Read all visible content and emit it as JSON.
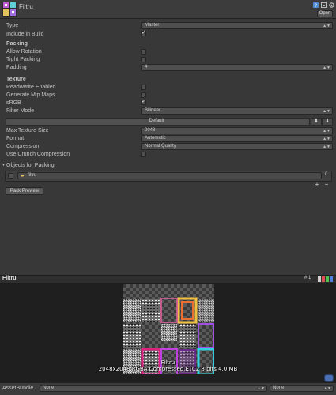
{
  "header": {
    "title": "Filtru",
    "open_label": "Open"
  },
  "settings": {
    "type_label": "Type",
    "type_value": "Master",
    "include_in_build_label": "Include in Build",
    "include_in_build": true,
    "packing_title": "Packing",
    "allow_rotation_label": "Allow Rotation",
    "allow_rotation": false,
    "tight_packing_label": "Tight Packing",
    "tight_packing": false,
    "padding_label": "Padding",
    "padding_value": "4",
    "texture_title": "Texture",
    "read_write_label": "Read/Write Enabled",
    "read_write": false,
    "mip_maps_label": "Generate Mip Maps",
    "mip_maps": false,
    "srgb_label": "sRGB",
    "srgb": true,
    "filter_mode_label": "Filter Mode",
    "filter_mode_value": "Bilinear"
  },
  "platform": {
    "tab_label": "Default",
    "max_texture_size_label": "Max Texture Size",
    "max_texture_size_value": "2048",
    "format_label": "Format",
    "format_value": "Automatic",
    "compression_label": "Compression",
    "compression_value": "Normal Quality",
    "crunch_label": "Use Crunch Compression",
    "crunch": false
  },
  "objects": {
    "title": "Objects for Packing",
    "item_label": "filtru",
    "item_index": "0",
    "add_label": "+",
    "remove_label": "−",
    "pack_preview_label": "Pack Preview"
  },
  "preview": {
    "title": "Filtru",
    "page_label": "# 1",
    "atlas_name": "Filtru",
    "atlas_info": "2048x2048 RGBA Compressed ETC2 8 bits   4.0 MB"
  },
  "assetbundle": {
    "label": "AssetBundle",
    "bundle_value": "None",
    "variant_value": "None"
  },
  "colors": {
    "background": "#383838",
    "preview_bg": "#1f1f1f",
    "accent_blue": "#4b6fb0"
  }
}
